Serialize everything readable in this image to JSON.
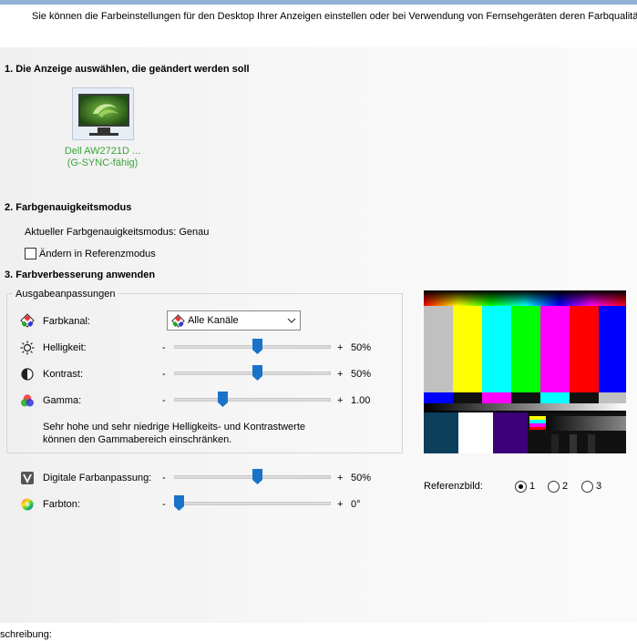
{
  "header": {
    "description": "Sie können die Farbeinstellungen für den Desktop Ihrer Anzeigen einstellen oder bei Verwendung von Fernsehgeräten deren Farbqualität verb"
  },
  "section1": {
    "title": "1. Die Anzeige auswählen, die geändert werden soll",
    "display_name_line1": "Dell AW2721D ...",
    "display_name_line2": "(G-SYNC-fähig)"
  },
  "section2": {
    "title": "2. Farbgenauigkeitsmodus",
    "current_mode": "Aktueller Farbgenauigkeitsmodus: Genau",
    "reference_mode_checkbox": {
      "label": "Ändern in Referenzmodus",
      "checked": false
    }
  },
  "section3": {
    "title": "3. Farbverbesserung anwenden",
    "group_label": "Ausgabeanpassungen",
    "farbkanal": {
      "label": "Farbkanal:",
      "value": "Alle Kanäle"
    },
    "helligkeit": {
      "label": "Helligkeit:",
      "minus": "-",
      "plus": "+",
      "value": "50%",
      "level": 0.5
    },
    "kontrast": {
      "label": "Kontrast:",
      "minus": "-",
      "plus": "+",
      "value": "50%",
      "level": 0.5
    },
    "gamma": {
      "label": "Gamma:",
      "minus": "-",
      "plus": "+",
      "value": "1.00",
      "level": 0.28
    },
    "note_line1": "Sehr hohe und sehr niedrige Helligkeits- und Kontrastwerte",
    "note_line2": "können den Gammabereich einschränken.",
    "digital": {
      "label": "Digitale Farbanpassung:",
      "minus": "-",
      "plus": "+",
      "value": "50%",
      "level": 0.5
    },
    "farbton": {
      "label": "Farbton:",
      "minus": "-",
      "plus": "+",
      "value": "0°",
      "level": 0.0
    }
  },
  "reference": {
    "label": "Referenzbild:",
    "options": [
      {
        "label": "1",
        "checked": true
      },
      {
        "label": "2",
        "checked": false
      },
      {
        "label": "3",
        "checked": false
      }
    ]
  },
  "footer": {
    "description_label": "schreibung:"
  },
  "colors": {
    "accent_thumb": "#1a73c8",
    "display_green": "#3aa53a",
    "topbar": "#8fb2d6"
  }
}
